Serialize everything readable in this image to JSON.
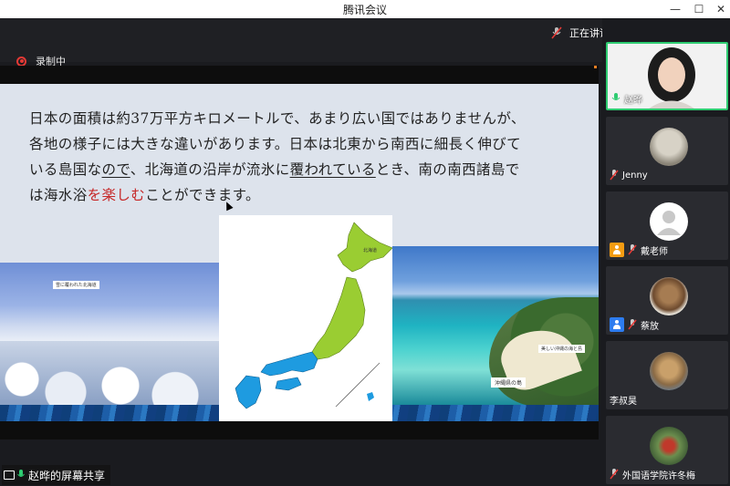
{
  "window": {
    "title": "腾讯会议",
    "controls": {
      "minimize": "—",
      "maximize": "☐",
      "close": "✕"
    }
  },
  "topbar": {
    "speaking_label": "正在讲话: 赵晔;",
    "recording_label": "录制中"
  },
  "slide": {
    "lines": {
      "l1": "日本の面積は約37万平方キロメートルで、あまり広い国ではありませんが、",
      "l2_pre": "各地の様子には大きな違いがあります。日本は北東から南西に細長く伸びて",
      "l3_a": "いる島国な",
      "l3_u1": "ので",
      "l3_b": "、北海道の沿岸が流氷に",
      "l3_u2": "覆われている",
      "l3_c": "とき、南の南西諸島で",
      "l4_a": "は海水浴",
      "l4_red": "を楽しむ",
      "l4_b": "ことができます。"
    },
    "left_photo_caption": "雪に覆われた北海道",
    "right_photo_caption1": "美しい沖縄の海と島",
    "right_photo_caption2": "沖縄県の島",
    "map_label_hokkaido": "北海道"
  },
  "share_label": "赵晔的屏幕共享",
  "participants": [
    {
      "name": "赵晔",
      "active": true,
      "badge": "",
      "mic": "on"
    },
    {
      "name": "Jenny",
      "active": false,
      "badge": "",
      "mic": "muted"
    },
    {
      "name": "戴老师",
      "active": false,
      "badge": "orange",
      "mic": "muted"
    },
    {
      "name": "蔡放",
      "active": false,
      "badge": "blue",
      "mic": "muted"
    },
    {
      "name": "李叔昊",
      "active": false,
      "badge": "",
      "mic": "none"
    },
    {
      "name": "外国语学院许冬梅",
      "active": false,
      "badge": "",
      "mic": "muted"
    }
  ],
  "colors": {
    "active_border": "#2ecc71",
    "record_red": "#e53935",
    "muted_red": "#e53935",
    "mic_green": "#2ecc71",
    "slide_bg": "#dde3ec",
    "map_green": "#9acd32",
    "map_blue": "#1e9be0"
  }
}
